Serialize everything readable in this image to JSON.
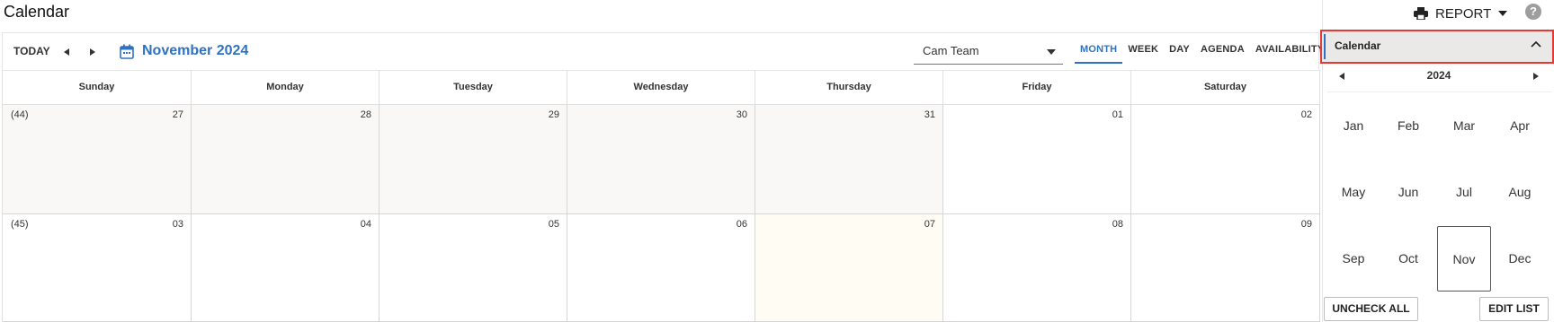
{
  "header": {
    "title": "Calendar",
    "report_label": "REPORT",
    "help_icon": "help-circle-icon"
  },
  "toolbar": {
    "today_label": "TODAY",
    "month_title": "November 2024",
    "team_select": {
      "value": "Cam Team"
    },
    "views": [
      "MONTH",
      "WEEK",
      "DAY",
      "AGENDA",
      "AVAILABILITY"
    ],
    "active_view": "MONTH"
  },
  "grid": {
    "day_names": [
      "Sunday",
      "Monday",
      "Tuesday",
      "Wednesday",
      "Thursday",
      "Friday",
      "Saturday"
    ],
    "weeks": [
      {
        "week_label": "(44)",
        "days": [
          {
            "num": "27",
            "other_month": true
          },
          {
            "num": "28",
            "other_month": true
          },
          {
            "num": "29",
            "other_month": true
          },
          {
            "num": "30",
            "other_month": true
          },
          {
            "num": "31",
            "other_month": true
          },
          {
            "num": "01",
            "other_month": false
          },
          {
            "num": "02",
            "other_month": false
          }
        ]
      },
      {
        "week_label": "(45)",
        "days": [
          {
            "num": "03",
            "other_month": false
          },
          {
            "num": "04",
            "other_month": false
          },
          {
            "num": "05",
            "other_month": false
          },
          {
            "num": "06",
            "other_month": false
          },
          {
            "num": "07",
            "other_month": false,
            "today": true
          },
          {
            "num": "08",
            "other_month": false
          },
          {
            "num": "09",
            "other_month": false
          }
        ]
      }
    ]
  },
  "side_panel": {
    "header_label": "Calendar",
    "year": "2024",
    "months": [
      "Jan",
      "Feb",
      "Mar",
      "Apr",
      "May",
      "Jun",
      "Jul",
      "Aug",
      "Sep",
      "Oct",
      "Nov",
      "Dec"
    ],
    "selected_month": "Nov",
    "uncheck_all_label": "UNCHECK ALL",
    "edit_list_label": "EDIT LIST"
  },
  "colors": {
    "accent": "#2f72c3",
    "highlight_border": "#e53935",
    "other_month_bg": "#f9f8f7",
    "today_bg": "#fffdf3"
  }
}
